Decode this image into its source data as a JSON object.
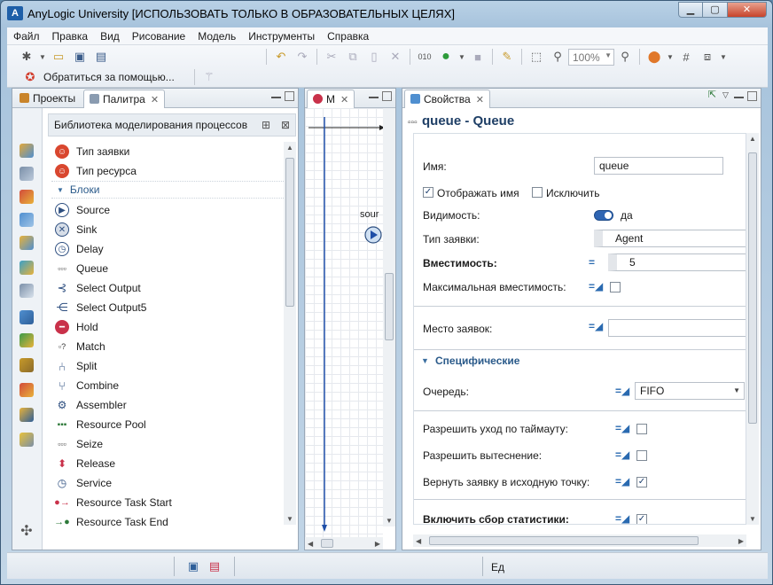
{
  "window": {
    "title": "AnyLogic University [ИСПОЛЬЗОВАТЬ ТОЛЬКО В ОБРАЗОВАТЕЛЬНЫХ ЦЕЛЯХ]",
    "logo_letter": "A"
  },
  "menu": [
    "Файл",
    "Правка",
    "Вид",
    "Рисование",
    "Модель",
    "Инструменты",
    "Справка"
  ],
  "toolbar": {
    "help_label": "Обратиться за помощью...",
    "zoom": "100%"
  },
  "left_panel": {
    "tabs": [
      {
        "label": "Проекты"
      },
      {
        "label": "Палитра"
      }
    ],
    "library_title": "Библиотека моделирования процессов",
    "top_items": [
      "Тип заявки",
      "Тип ресурса"
    ],
    "group_label": "Блоки",
    "blocks": [
      {
        "label": "Source",
        "icon": "source-icon"
      },
      {
        "label": "Sink",
        "icon": "sink-icon"
      },
      {
        "label": "Delay",
        "icon": "delay-icon"
      },
      {
        "label": "Queue",
        "icon": "queue-icon"
      },
      {
        "label": "Select Output",
        "icon": "select-output-icon"
      },
      {
        "label": "Select Output5",
        "icon": "select-output5-icon"
      },
      {
        "label": "Hold",
        "icon": "hold-icon"
      },
      {
        "label": "Match",
        "icon": "match-icon"
      },
      {
        "label": "Split",
        "icon": "split-icon"
      },
      {
        "label": "Combine",
        "icon": "combine-icon"
      },
      {
        "label": "Assembler",
        "icon": "assembler-icon"
      },
      {
        "label": "Resource Pool",
        "icon": "resource-pool-icon"
      },
      {
        "label": "Seize",
        "icon": "seize-icon"
      },
      {
        "label": "Release",
        "icon": "release-icon"
      },
      {
        "label": "Service",
        "icon": "service-icon"
      },
      {
        "label": "Resource Task Start",
        "icon": "resource-task-start-icon"
      },
      {
        "label": "Resource Task End",
        "icon": "resource-task-end-icon"
      }
    ]
  },
  "editor": {
    "tab_label": "M",
    "canvas_label": "sour"
  },
  "properties": {
    "tab_label": "Свойства",
    "title": "queue - Queue",
    "name_label": "Имя:",
    "name_value": "queue",
    "show_name_label": "Отображать имя",
    "show_name_checked": true,
    "exclude_label": "Исключить",
    "exclude_checked": false,
    "visibility_label": "Видимость:",
    "visibility_value": "да",
    "agent_type_label": "Тип заявки:",
    "agent_type_value": "Agent",
    "capacity_label": "Вместимость:",
    "capacity_value": "5",
    "max_capacity_label": "Максимальная вместимость:",
    "max_capacity_checked": false,
    "location_label": "Место заявок:",
    "location_value": "",
    "section_specific": "Специфические",
    "queue_label": "Очередь:",
    "queue_value": "FIFO",
    "timeout_label": "Разрешить уход по таймауту:",
    "timeout_checked": false,
    "preempt_label": "Разрешить вытеснение:",
    "preempt_checked": false,
    "return_label": "Вернуть заявку в исходную точку:",
    "return_checked": true,
    "stats_label": "Включить сбор статистики:",
    "stats_checked": true
  },
  "status": {
    "right_text": "Ед"
  },
  "colors": {
    "accent": "#2f65b3",
    "title_text": "#1f3f66",
    "section_text": "#2a5a8a"
  }
}
